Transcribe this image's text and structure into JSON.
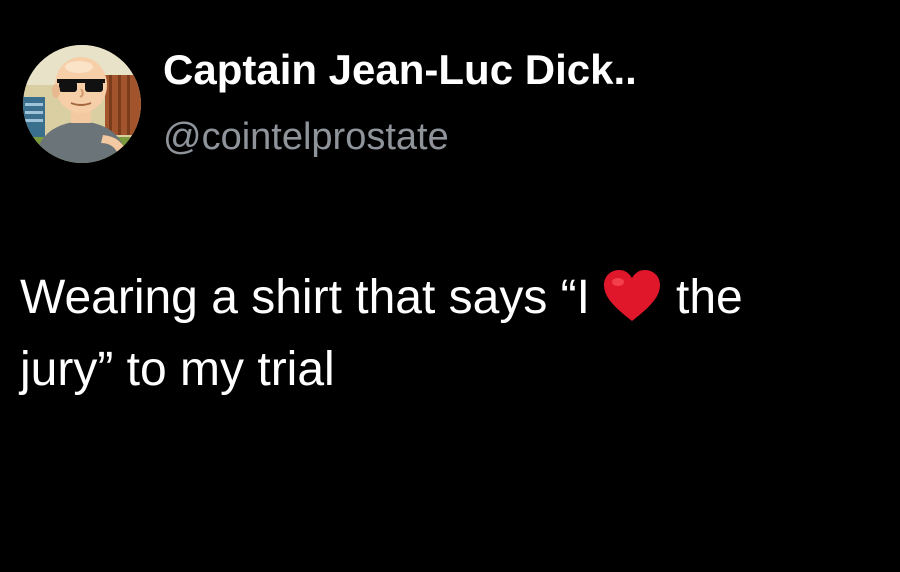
{
  "profile": {
    "display_name": "Captain Jean-Luc Dick..",
    "handle": "@cointelprostate",
    "avatar_icon": "cartoon-man-with-sunglasses-avatar"
  },
  "tweet": {
    "line1_before_emoji": "Wearing a shirt that says “I",
    "emoji": "heart-icon",
    "line1_after_emoji": "the",
    "line2": "jury” to my trial"
  },
  "colors": {
    "background": "#000000",
    "primary_text": "#ffffff",
    "secondary_text": "#8e949a",
    "heart": "#e0162b"
  }
}
